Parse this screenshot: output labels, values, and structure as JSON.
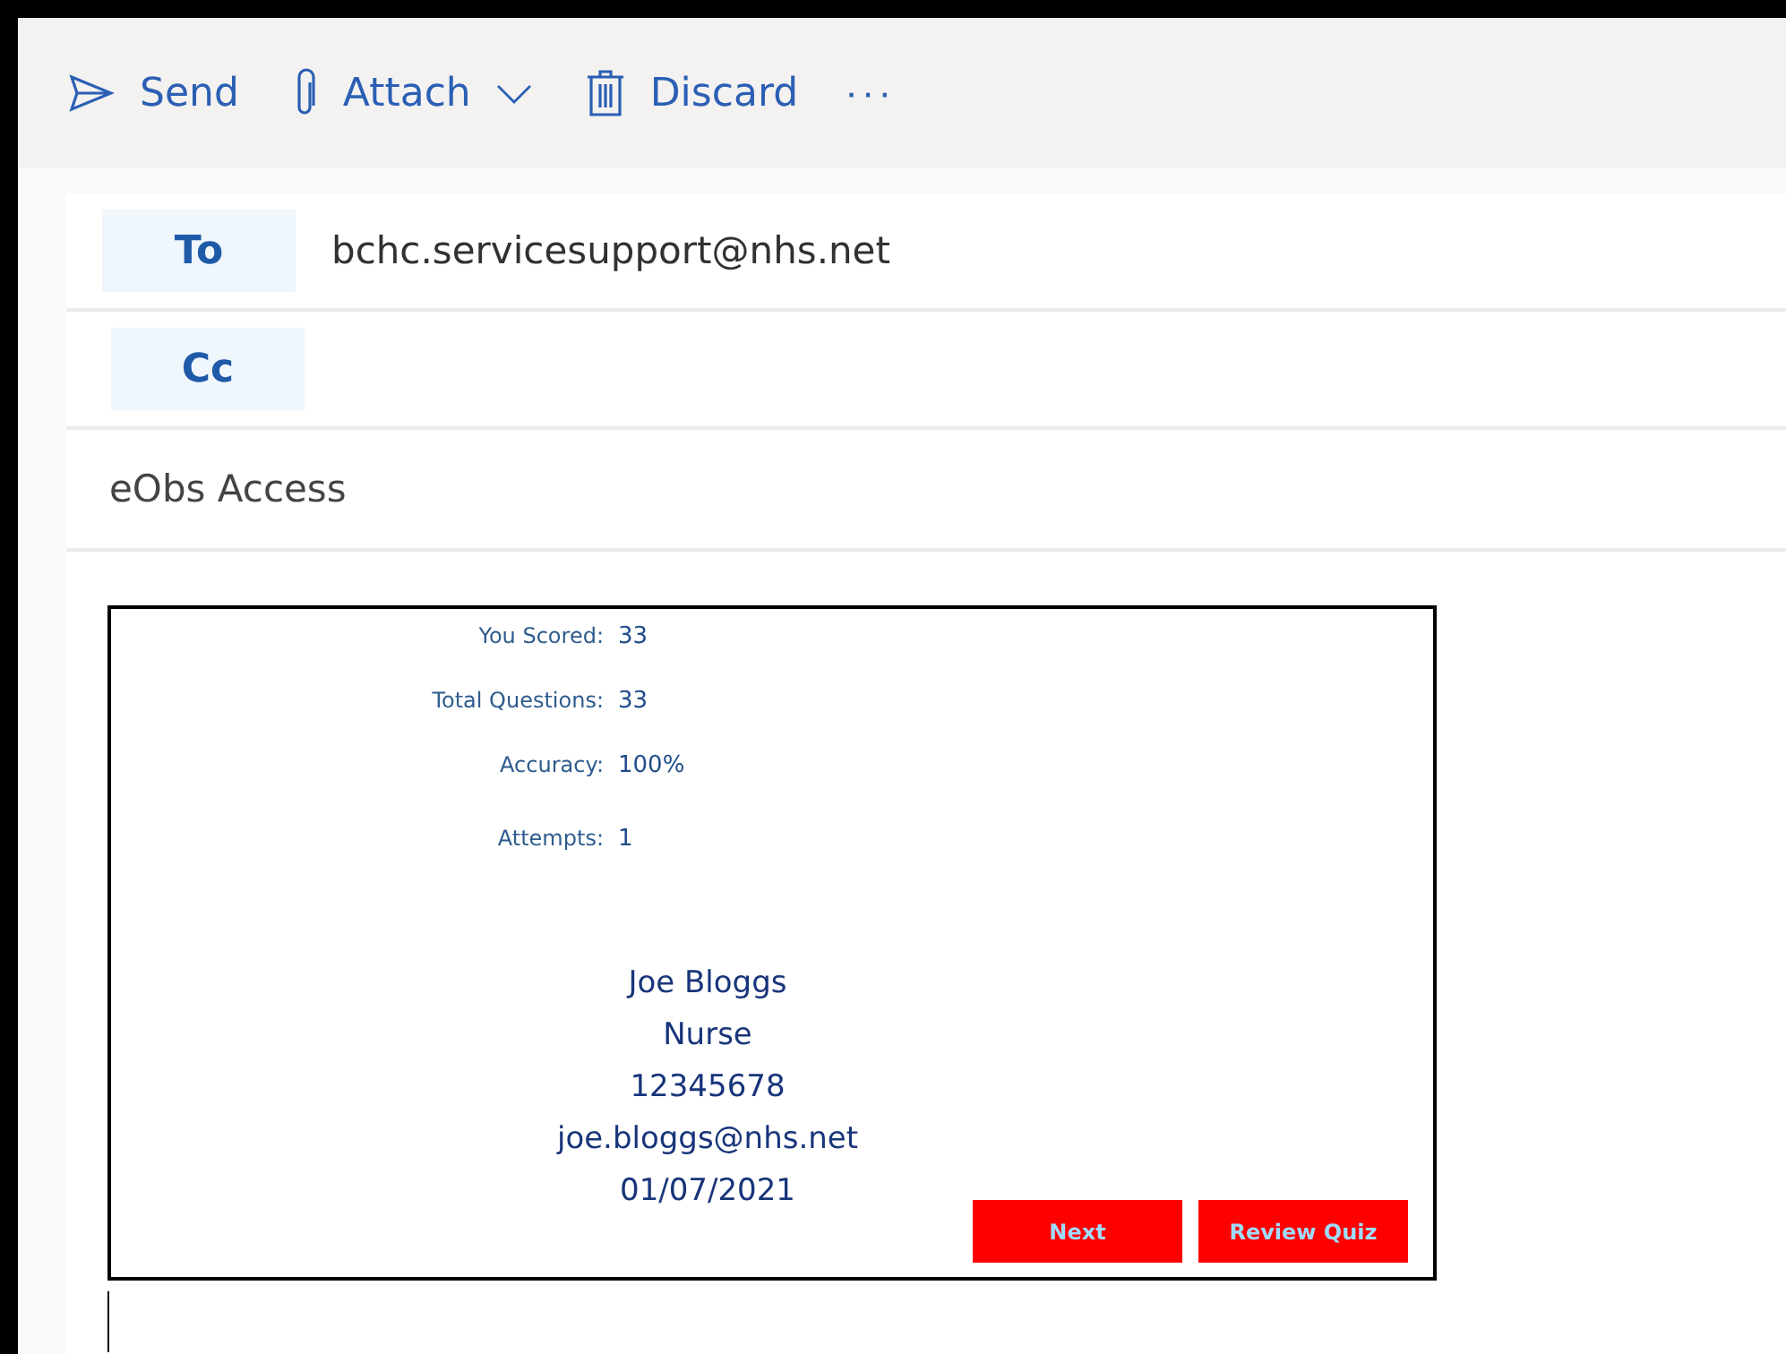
{
  "toolbar": {
    "actions": [
      {
        "kind": "send",
        "label": "Send"
      },
      {
        "kind": "attach",
        "label": "Attach"
      },
      {
        "kind": "discard",
        "label": "Discard"
      },
      {
        "kind": "more",
        "label": "···"
      }
    ]
  },
  "recipients": [
    {
      "label": "To",
      "value": "bchc.servicesupport@nhs.net"
    },
    {
      "label": "Cc"
    }
  ],
  "subject": "eObs Access",
  "quiz_result": {
    "stats": [
      {
        "label": "You Scored:",
        "value": "33"
      },
      {
        "label": "Total Questions:",
        "value": "33"
      },
      {
        "label": "Accuracy:",
        "value": "100%"
      },
      {
        "label": "Attempts:",
        "value": "1"
      }
    ],
    "details": [
      "Joe Bloggs",
      "Nurse",
      "12345678",
      "joe.bloggs@nhs.net",
      "01/07/2021"
    ],
    "buttons": [
      "Next",
      "Review Quiz"
    ]
  }
}
